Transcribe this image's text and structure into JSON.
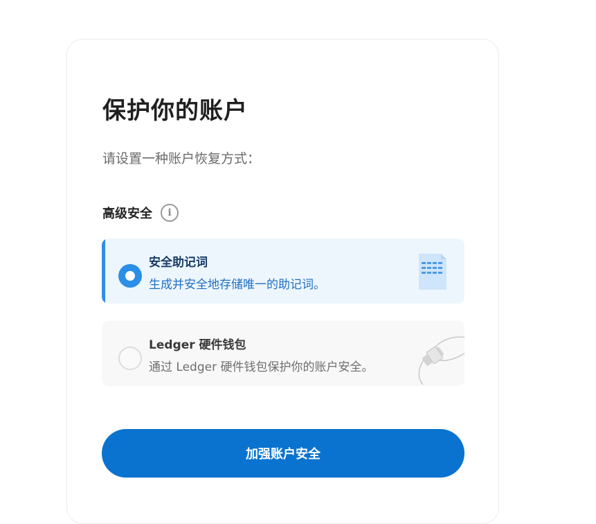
{
  "page": {
    "title": "保护你的账户",
    "subtitle": "请设置一种账户恢复方式："
  },
  "section": {
    "label": "高级安全",
    "info_icon": "info-icon"
  },
  "options": [
    {
      "title": "安全助记词",
      "description": "生成并安全地存储唯一的助记词。",
      "selected": true,
      "icon": "document-icon"
    },
    {
      "title": "Ledger 硬件钱包",
      "description": "通过 Ledger 硬件钱包保护你的账户安全。",
      "selected": false,
      "icon": "usb-device-icon"
    }
  ],
  "cta": {
    "label": "加强账户安全"
  },
  "colors": {
    "accent": "#0a73cf",
    "selected_bg": "#eef6fd",
    "selected_bar": "#2f8ee8"
  }
}
